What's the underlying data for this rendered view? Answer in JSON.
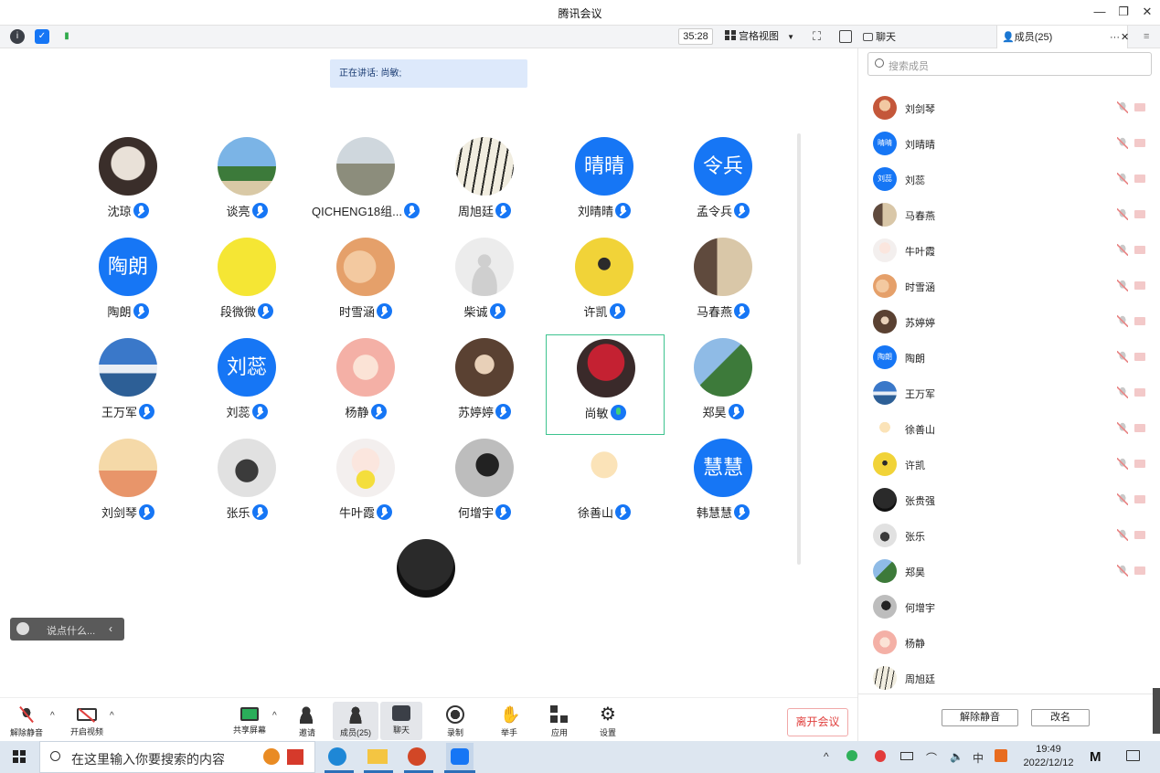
{
  "window": {
    "title": "腾讯会议"
  },
  "toolbar": {
    "timer": "35:28",
    "view_mode": "宫格视图"
  },
  "sidetabs": {
    "chat": "聊天",
    "members": "成员(25)"
  },
  "stage": {
    "speaking": "正在讲话: 尚敏;",
    "chat_placeholder": "说点什么..."
  },
  "participants": [
    {
      "name": "沈琼",
      "avatar": "photo"
    },
    {
      "name": "谈亮",
      "avatar": "photo"
    },
    {
      "name": "QICHENG18组...",
      "avatar": "photo"
    },
    {
      "name": "周旭廷",
      "avatar": "photo"
    },
    {
      "name": "刘晴晴",
      "avatar": "text",
      "initials": "晴晴"
    },
    {
      "name": "孟令兵",
      "avatar": "text",
      "initials": "令兵"
    },
    {
      "name": "陶朗",
      "avatar": "text",
      "initials": "陶朗"
    },
    {
      "name": "段微微",
      "avatar": "photo"
    },
    {
      "name": "时雪涵",
      "avatar": "photo"
    },
    {
      "name": "柴诚",
      "avatar": "default"
    },
    {
      "name": "许凯",
      "avatar": "photo"
    },
    {
      "name": "马春燕",
      "avatar": "photo"
    },
    {
      "name": "王万军",
      "avatar": "photo"
    },
    {
      "name": "刘蕊",
      "avatar": "text",
      "initials": "刘蕊"
    },
    {
      "name": "杨静",
      "avatar": "photo"
    },
    {
      "name": "苏婷婷",
      "avatar": "photo"
    },
    {
      "name": "尚敏",
      "avatar": "photo",
      "speaking": true
    },
    {
      "name": "郑昊",
      "avatar": "photo"
    },
    {
      "name": "刘剑琴",
      "avatar": "photo"
    },
    {
      "name": "张乐",
      "avatar": "photo"
    },
    {
      "name": "牛叶霞",
      "avatar": "photo"
    },
    {
      "name": "何增宇",
      "avatar": "photo"
    },
    {
      "name": "徐善山",
      "avatar": "photo"
    },
    {
      "name": "韩慧慧",
      "avatar": "text",
      "initials": "慧慧"
    }
  ],
  "controls": {
    "unmute": "解除静音",
    "start_video": "开启视频",
    "share_screen": "共享屏幕",
    "invite": "邀请",
    "members": "成员(25)",
    "chat": "聊天",
    "record": "录制",
    "raise_hand": "举手",
    "apps": "应用",
    "settings": "设置",
    "leave": "离开会议"
  },
  "panel": {
    "search_placeholder": "搜索成员",
    "members": [
      {
        "name": "刘剑琴",
        "initials": "",
        "camera": true
      },
      {
        "name": "刘晴晴",
        "initials": "晴晴",
        "camera": true
      },
      {
        "name": "刘蕊",
        "initials": "刘蕊",
        "camera": true
      },
      {
        "name": "马春燕",
        "initials": "",
        "camera": true
      },
      {
        "name": "牛叶霞",
        "initials": "",
        "camera": true
      },
      {
        "name": "时雪涵",
        "initials": "",
        "camera": true
      },
      {
        "name": "苏婷婷",
        "initials": "",
        "camera": true
      },
      {
        "name": "陶朗",
        "initials": "陶朗",
        "camera": true
      },
      {
        "name": "王万军",
        "initials": "",
        "camera": true
      },
      {
        "name": "徐善山",
        "initials": "",
        "camera": true
      },
      {
        "name": "许凯",
        "initials": "",
        "camera": true
      },
      {
        "name": "张贵强",
        "initials": "",
        "camera": true
      },
      {
        "name": "张乐",
        "initials": "",
        "camera": true
      },
      {
        "name": "郑昊",
        "initials": "",
        "camera": true
      },
      {
        "name": "何增宇",
        "initials": "",
        "camera": false
      },
      {
        "name": "杨静",
        "initials": "",
        "camera": false
      },
      {
        "name": "周旭廷",
        "initials": "",
        "camera": false
      }
    ],
    "unmute_all": "解除静音",
    "rename": "改名"
  },
  "taskbar": {
    "search_placeholder": "在这里输入你要搜索的内容",
    "time": "19:49",
    "date": "2022/12/12",
    "ime": "中"
  }
}
